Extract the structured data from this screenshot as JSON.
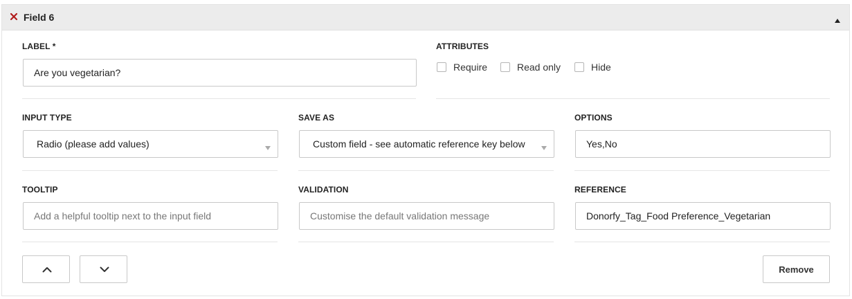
{
  "header": {
    "title": "Field 6",
    "close_icon": "close-icon",
    "collapse_icon": "triangle-up-icon",
    "accent_color": "#b11b1b"
  },
  "label_field": {
    "label": "LABEL *",
    "value": "Are you vegetarian?"
  },
  "attributes": {
    "label": "ATTRIBUTES",
    "options": [
      {
        "label": "Require",
        "checked": false
      },
      {
        "label": "Read only",
        "checked": false
      },
      {
        "label": "Hide",
        "checked": false
      }
    ]
  },
  "input_type": {
    "label": "INPUT TYPE",
    "value": "Radio (please add values)"
  },
  "save_as": {
    "label": "SAVE AS",
    "value": "Custom field - see automatic reference key below"
  },
  "options_field": {
    "label": "OPTIONS",
    "value": "Yes,No"
  },
  "tooltip_field": {
    "label": "TOOLTIP",
    "placeholder": "Add a helpful tooltip next to the input field",
    "value": ""
  },
  "validation_field": {
    "label": "VALIDATION",
    "placeholder": "Customise the default validation message",
    "value": ""
  },
  "reference_field": {
    "label": "REFERENCE",
    "value": "Donorfy_Tag_Food Preference_Vegetarian"
  },
  "footer": {
    "move_up_icon": "chevron-up-icon",
    "move_down_icon": "chevron-down-icon",
    "remove_label": "Remove"
  }
}
